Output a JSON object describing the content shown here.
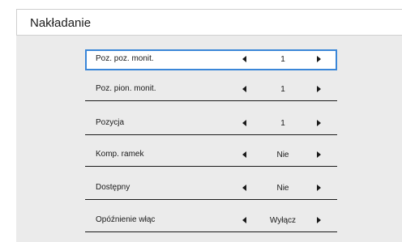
{
  "title": "Nakładanie",
  "colors": {
    "background": "#ebebeb",
    "selected_border": "#3a86d8",
    "text": "#1a1a1a"
  },
  "icons": {
    "decrease": "triangle-left-icon",
    "increase": "triangle-right-icon"
  },
  "rows": [
    {
      "label": "Poz. poz. monit.",
      "value": "1",
      "selected": true
    },
    {
      "label": "Poz. pion. monit.",
      "value": "1",
      "selected": false
    },
    {
      "label": "Pozycja",
      "value": "1",
      "selected": false
    },
    {
      "label": "Komp.  ramek",
      "value": "Nie",
      "selected": false
    },
    {
      "label": "Dostępny",
      "value": "Nie",
      "selected": false
    },
    {
      "label": "Opóźnienie włąc",
      "value": "Wyłącz",
      "selected": false
    }
  ]
}
